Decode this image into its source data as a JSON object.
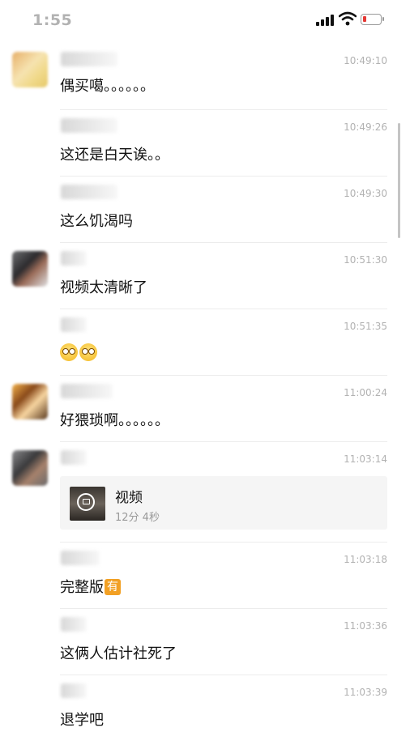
{
  "status_bar": {
    "time": "1:55"
  },
  "messages": [
    {
      "time": "10:49:10",
      "text": "偶买噶。。。。。。"
    },
    {
      "time": "10:49:26",
      "text": "这还是白天诶。。"
    },
    {
      "time": "10:49:30",
      "text": "这么饥渴吗"
    },
    {
      "time": "10:51:30",
      "text": "视频太清晰了"
    },
    {
      "time": "10:51:35",
      "text": ""
    },
    {
      "time": "11:00:24",
      "text": "好猥琐啊。。。。。。"
    },
    {
      "time": "11:03:14",
      "video_title": "视频",
      "video_duration": "12分 4秒"
    },
    {
      "time": "11:03:18",
      "text": "完整版",
      "badge": "有"
    },
    {
      "time": "11:03:36",
      "text": "这俩人估计社死了"
    },
    {
      "time": "11:03:39",
      "text": "退学吧"
    }
  ],
  "colors": {
    "badge": "#f2a024",
    "timestamp": "#b2b2b2",
    "divider": "#ececec"
  }
}
